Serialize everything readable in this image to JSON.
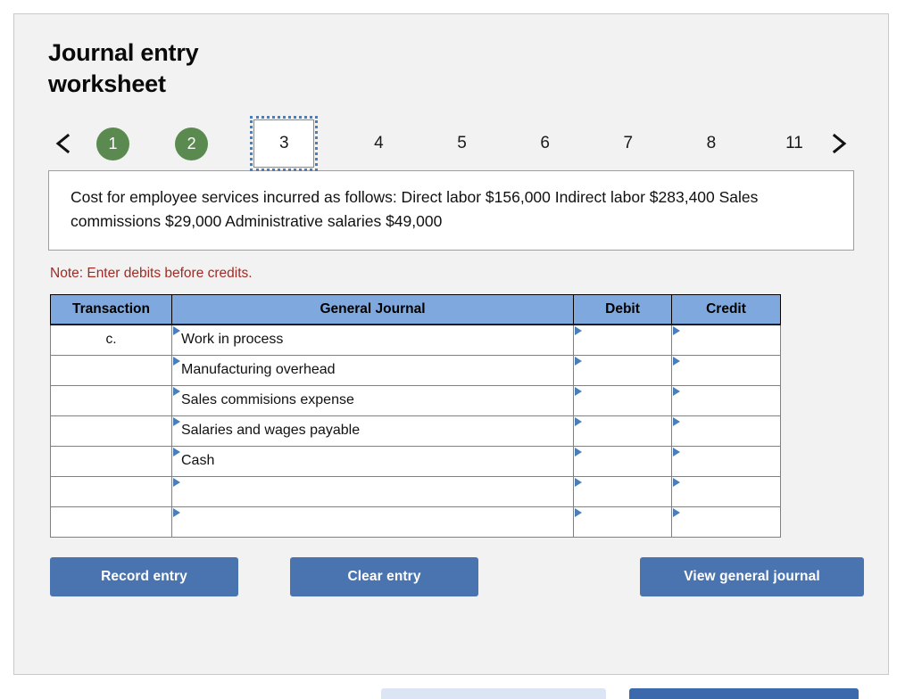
{
  "page": {
    "title": "Journal entry worksheet"
  },
  "stepper": {
    "prev_label": "‹",
    "next_label": "›",
    "steps": [
      {
        "label": "1",
        "state": "done"
      },
      {
        "label": "2",
        "state": "done"
      },
      {
        "label": "3",
        "state": "active"
      },
      {
        "label": "4",
        "state": "idle"
      },
      {
        "label": "5",
        "state": "idle"
      },
      {
        "label": "6",
        "state": "idle"
      },
      {
        "label": "7",
        "state": "idle"
      },
      {
        "label": "8",
        "state": "idle"
      },
      {
        "label": "11",
        "state": "idle"
      }
    ]
  },
  "question": {
    "text": "Cost for employee services incurred as follows: Direct labor $156,000 Indirect labor $283,400 Sales commissions $29,000 Administrative salaries $49,000"
  },
  "note": {
    "text": "Note: Enter debits before credits."
  },
  "journal": {
    "headers": {
      "transaction": "Transaction",
      "general_journal": "General Journal",
      "debit": "Debit",
      "credit": "Credit"
    },
    "rows": [
      {
        "transaction": "c.",
        "account": "Work in process",
        "debit": "",
        "credit": ""
      },
      {
        "transaction": "",
        "account": "Manufacturing overhead",
        "debit": "",
        "credit": ""
      },
      {
        "transaction": "",
        "account": "Sales commisions expense",
        "debit": "",
        "credit": ""
      },
      {
        "transaction": "",
        "account": "Salaries and wages payable",
        "debit": "",
        "credit": ""
      },
      {
        "transaction": "",
        "account": "Cash",
        "debit": "",
        "credit": ""
      },
      {
        "transaction": "",
        "account": "",
        "debit": "",
        "credit": ""
      },
      {
        "transaction": "",
        "account": "",
        "debit": "",
        "credit": ""
      }
    ]
  },
  "actions": {
    "record_entry": "Record entry",
    "clear_entry": "Clear entry",
    "view_general_journal": "View general journal"
  },
  "colors": {
    "header_blue": "#7fa9de",
    "button_blue": "#4a74b0",
    "step_done_green": "#5b8a50",
    "active_outline_blue": "#4a7ebb",
    "note_red": "#9e2b25",
    "panel_bg": "#f2f2f2"
  }
}
